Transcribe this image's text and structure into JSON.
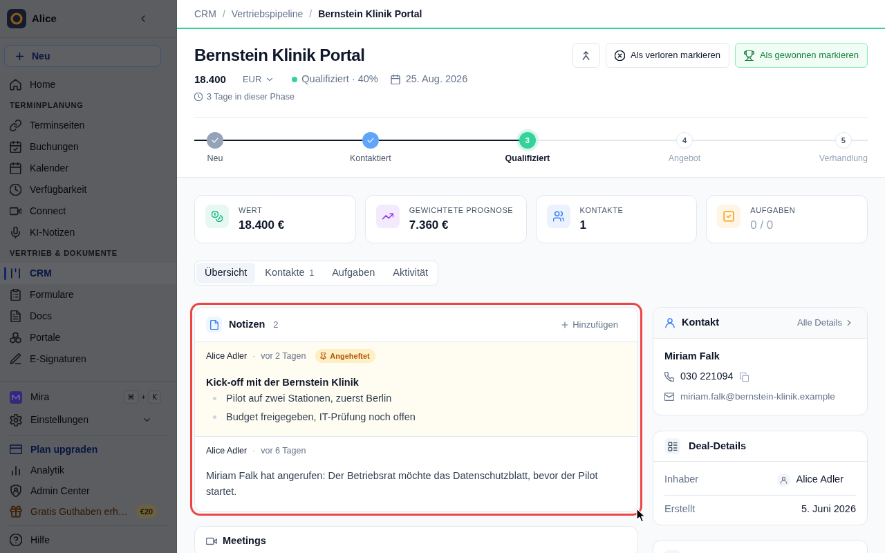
{
  "sidebar": {
    "workspace": "Alice",
    "new_button": "Neu",
    "sections": [
      {
        "items": [
          {
            "label": "Home",
            "selected": false
          }
        ]
      },
      {
        "title": "TERMINPLANUNG",
        "items": [
          {
            "label": "Terminseiten",
            "selected": false
          },
          {
            "label": "Buchungen",
            "selected": false
          },
          {
            "label": "Kalender",
            "selected": false
          },
          {
            "label": "Verfügbarkeit",
            "selected": false
          },
          {
            "label": "Connect",
            "selected": false
          },
          {
            "label": "KI-Notizen",
            "selected": false
          }
        ]
      },
      {
        "title": "VERTRIEB & DOKUMENTE",
        "items": [
          {
            "label": "CRM",
            "selected": true
          },
          {
            "label": "Formulare",
            "selected": false
          },
          {
            "label": "Docs",
            "selected": false
          },
          {
            "label": "Portale",
            "selected": false
          },
          {
            "label": "E-Signaturen",
            "selected": false
          }
        ]
      }
    ],
    "tools": [
      {
        "label": "Mira",
        "shortcut": {
          "keys": [
            "⌘",
            "K"
          ],
          "joiner": "+"
        }
      },
      {
        "label": "Einstellungen",
        "expanded": false
      }
    ],
    "links": [
      {
        "label": "Plan upgraden",
        "kind": "upgrade"
      },
      {
        "label": "Analytik",
        "kind": "plain"
      },
      {
        "label": "Admin Center",
        "kind": "plain"
      },
      {
        "label": "Gratis Guthaben erh…",
        "kind": "promo",
        "badge": "€20"
      }
    ],
    "help": "Hilfe"
  },
  "breadcrumb": {
    "items": [
      "CRM",
      "Vertriebspipeline",
      "Bernstein Klinik Portal"
    ],
    "separator": "/"
  },
  "deal": {
    "title": "Bernstein Klinik Portal",
    "amount": "18.400",
    "currency": "EUR",
    "stage": "Qualifiziert",
    "probability": "· 40%",
    "close_date": "25. Aug. 2026",
    "phase_age": "3 Tage in dieser Phase"
  },
  "actions": [
    {
      "kind": "lost",
      "label": "Als verloren markieren"
    },
    {
      "kind": "won",
      "label": "Als gewonnen markieren"
    }
  ],
  "stages": [
    {
      "label": "Neu",
      "completed": true,
      "current": false,
      "color": "#94a3b8"
    },
    {
      "label": "Kontaktiert",
      "completed": true,
      "current": false,
      "color": "#60a5fa"
    },
    {
      "label": "Qualifiziert",
      "completed": false,
      "current": true,
      "color": "#34d399",
      "number": "3"
    },
    {
      "label": "Angebot",
      "completed": false,
      "current": false,
      "number": "4"
    },
    {
      "label": "Verhandlung",
      "completed": false,
      "current": false,
      "number": "5"
    }
  ],
  "stats": [
    {
      "label": "WERT",
      "value": "18.400 €",
      "color": "#10b981",
      "muted": false
    },
    {
      "label": "GEWICHTETE PROGNOSE",
      "value": "7.360 €",
      "color": "#9333ea",
      "muted": false
    },
    {
      "label": "KONTAKTE",
      "value": "1",
      "color": "#3b82f6",
      "muted": false
    },
    {
      "label": "AUFGABEN",
      "value": "0 / 0",
      "color": "#f59e0b",
      "muted": true
    }
  ],
  "tabs": [
    {
      "label": "Übersicht",
      "selected": true
    },
    {
      "label": "Kontakte",
      "count": "1",
      "selected": false
    },
    {
      "label": "Aufgaben",
      "selected": false
    },
    {
      "label": "Aktivität",
      "selected": false
    }
  ],
  "notes": {
    "title": "Notizen",
    "count": "2",
    "add_label": "Hinzufügen",
    "highlighted": true,
    "items": [
      {
        "author": "Alice Adler",
        "separator": "·",
        "time": "vor 2 Tagen",
        "pinned": true,
        "pin_label": "Angeheftet",
        "title": "Kick-off mit der Bernstein Klinik",
        "bullets": [
          "Pilot auf zwei Stationen, zuerst Berlin",
          "Budget freigegeben, IT-Prüfung noch offen"
        ]
      },
      {
        "author": "Alice Adler",
        "separator": "·",
        "time": "vor 6 Tagen",
        "pinned": false,
        "text": "Miriam Falk hat angerufen: Der Betriebsrat möchte das Datenschutzblatt, bevor der Pilot startet."
      }
    ]
  },
  "meetings": {
    "title": "Meetings"
  },
  "contact": {
    "title": "Kontakt",
    "link": "Alle Details",
    "name": "Miriam Falk",
    "phone": "030 221094",
    "email": "miriam.falk@bernstein-klinik.example"
  },
  "deal_details": {
    "title": "Deal-Details",
    "rows": [
      {
        "kind": "person",
        "label": "Inhaber",
        "value": "Alice Adler"
      },
      {
        "kind": "text",
        "label": "Erstellt",
        "value": "5. Juni 2026"
      }
    ]
  }
}
